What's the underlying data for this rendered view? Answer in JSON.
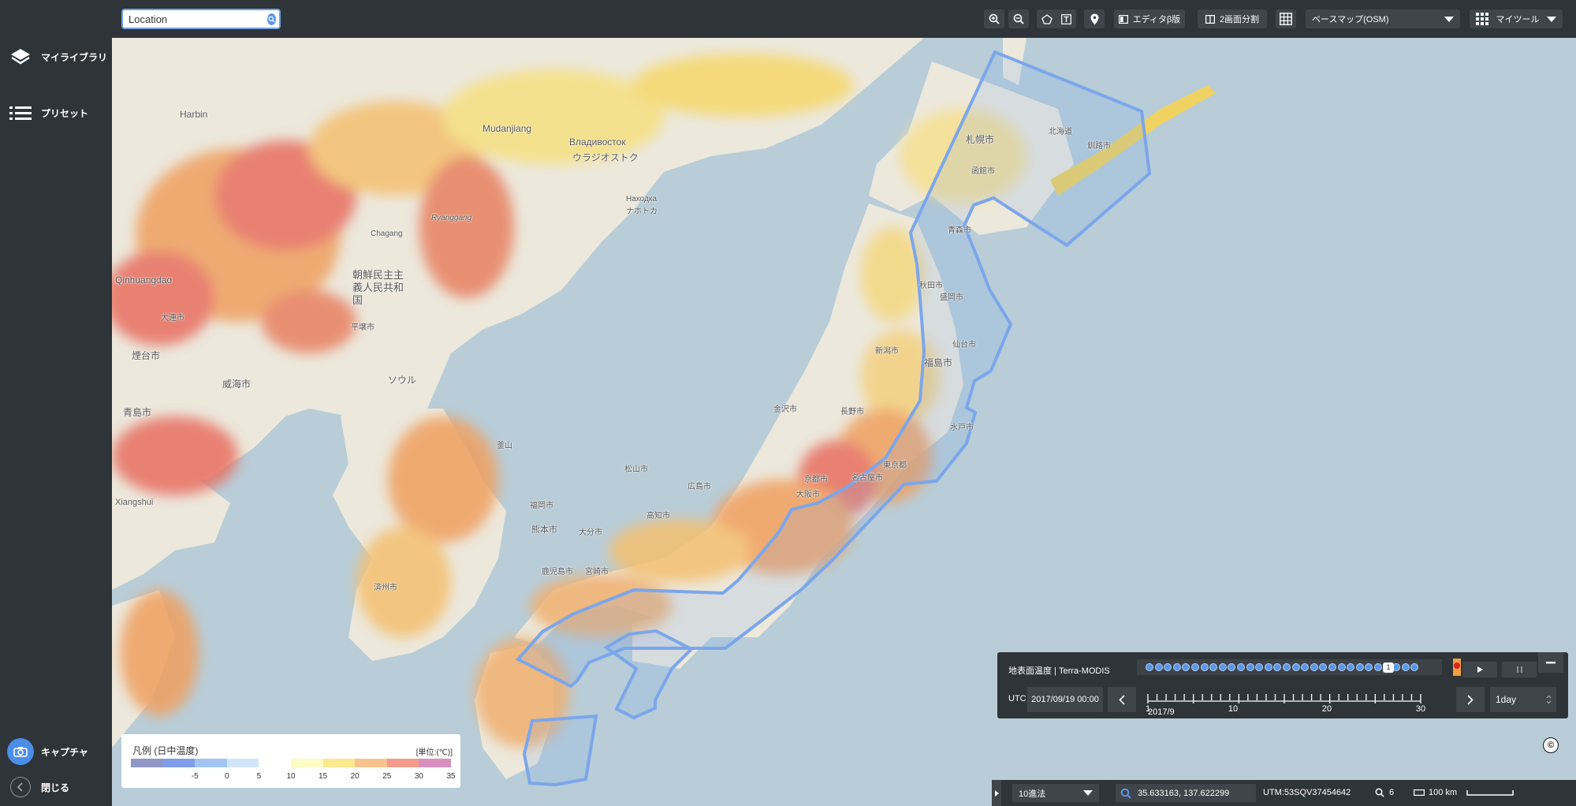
{
  "sidebar": {
    "items": [
      {
        "label": "マイライブラリ",
        "icon": "layers-icon"
      },
      {
        "label": "プリセット",
        "icon": "list-icon"
      }
    ],
    "bottom": [
      {
        "label": "キャプチャ",
        "icon": "camera-icon"
      },
      {
        "label": "閉じる",
        "icon": "chevron-left-icon"
      }
    ]
  },
  "topbar": {
    "search_value": "Location",
    "editor_label": "エディタβ版",
    "split_label": "2画面分割",
    "basemap_value": "ベースマップ(OSM)",
    "mytools_label": "マイツール"
  },
  "map": {
    "places": [
      "Harbin",
      "Mudanjiang",
      "Владивосток",
      "ウラジオストク",
      "Находка",
      "ナホトカ",
      "Ryanggang",
      "Chagang",
      "朝鮮民主主義人民共和国",
      "Qinhuangdao",
      "札幌市",
      "北海道",
      "釧路市",
      "函館市",
      "青森市",
      "秋田市",
      "盛岡市",
      "仙台市",
      "新潟市",
      "福島市",
      "金沢市",
      "長野市",
      "名古屋市",
      "大阪市",
      "京都市",
      "広島市",
      "福岡市",
      "熊本市",
      "鹿児島市",
      "宮崎市",
      "大分市",
      "高知市",
      "松山市",
      "平壌市",
      "ソウル",
      "大連市",
      "煙台市",
      "威海市",
      "青島市",
      "済州市",
      "東京都",
      "水戸市",
      "Xiangshui",
      "釜山"
    ]
  },
  "legend": {
    "title": "凡例 (日中温度)",
    "unit": "[単位:(℃)]",
    "ticks": [
      "-5",
      "0",
      "5",
      "10",
      "15",
      "20",
      "25",
      "30",
      "35"
    ],
    "colors": [
      "#8e97c6",
      "#7f9de8",
      "#a2c4f2",
      "#d2e6fa",
      "#ffffff",
      "#fdfbc4",
      "#fbe88f",
      "#f8c38e",
      "#f39b8c",
      "#d88fbd"
    ]
  },
  "timepanel": {
    "title": "地表面温度 | Terra-MODIS",
    "utc_label": "UTC",
    "datetime": "2017/09/19 00:00",
    "month": "2017/9",
    "ruler_labels": [
      "1",
      "10",
      "20",
      "30"
    ],
    "flag_label": "1",
    "step_value": "1day"
  },
  "status": {
    "coord_system": "10進法",
    "coords": "35.633163, 137.622299",
    "utm": "UTM:53SQV37454642",
    "zoom": "6",
    "scale": "100 km"
  },
  "copyright": "©",
  "accent_color": "#4a8ee8"
}
